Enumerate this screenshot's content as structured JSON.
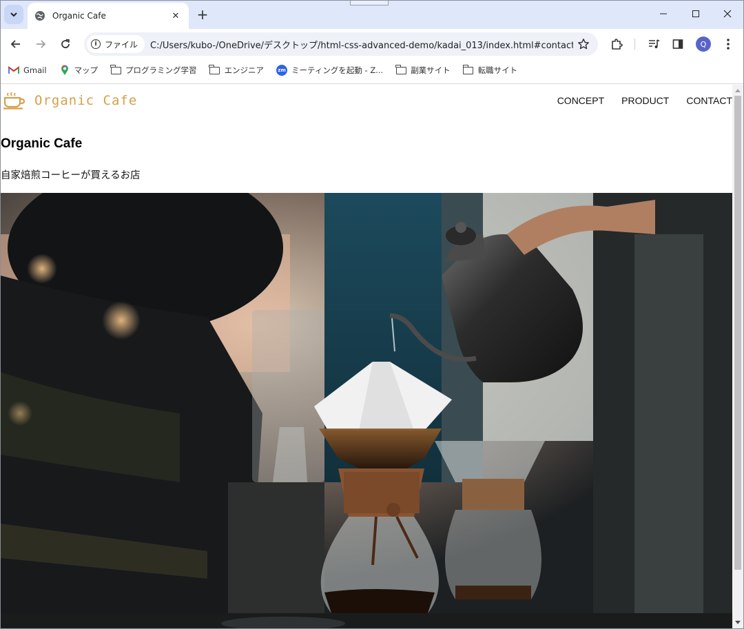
{
  "browser": {
    "tab_title": "Organic Cafe",
    "url_chip": "ファイル",
    "url": "C:/Users/kubo-/OneDrive/デスクトップ/html-css-advanced-demo/kadai_013/index.html#contact",
    "profile_initial": "Q",
    "bookmarks": [
      {
        "label": "Gmail",
        "icon": "gmail-icon"
      },
      {
        "label": "マップ",
        "icon": "maps-icon"
      },
      {
        "label": "プログラミング学習",
        "icon": "folder-icon"
      },
      {
        "label": "エンジニア",
        "icon": "folder-icon"
      },
      {
        "label": "ミーティングを起動 - Z...",
        "icon": "zoom-icon"
      },
      {
        "label": "副業サイト",
        "icon": "folder-icon"
      },
      {
        "label": "転職サイト",
        "icon": "folder-icon"
      }
    ],
    "zoom_icon_text": "zm"
  },
  "site": {
    "logo_text": "Organic Cafe",
    "nav": [
      "CONCEPT",
      "PRODUCT",
      "CONTACT"
    ],
    "hero_title": "Organic Cafe",
    "hero_subtitle": "自家焙煎コーヒーが買えるお店"
  },
  "colors": {
    "logo_accent": "#d5a04b",
    "tabstrip": "#dfe7fb"
  }
}
